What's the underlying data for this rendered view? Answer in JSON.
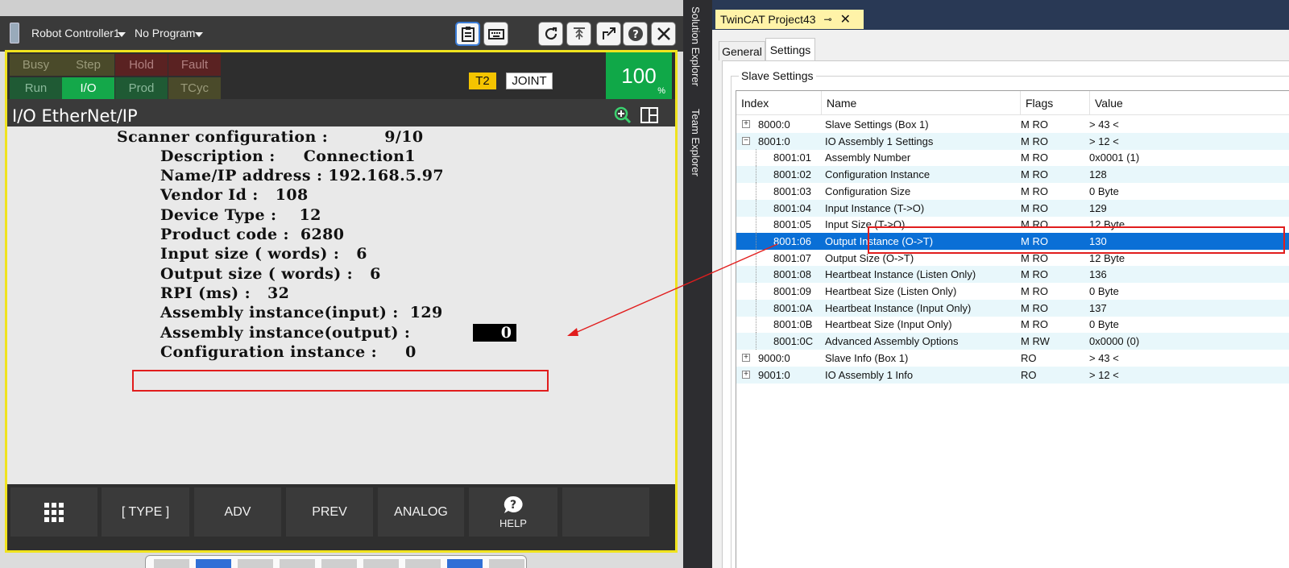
{
  "pendant": {
    "controller_name": "Robot Controller1",
    "program": "No Program",
    "status_row1": [
      {
        "label": "Busy",
        "bg": "#4a4a2a",
        "fg": "#9a9a7a"
      },
      {
        "label": "Step",
        "bg": "#4a4a2a",
        "fg": "#9a9a7a"
      },
      {
        "label": "Hold",
        "bg": "#5a2222",
        "fg": "#b08080"
      },
      {
        "label": "Fault",
        "bg": "#5a2222",
        "fg": "#b08080"
      }
    ],
    "status_row2": [
      {
        "label": "Run",
        "bg": "#1f5a34",
        "fg": "#8ab89a"
      },
      {
        "label": "I/O",
        "bg": "#14a84a",
        "fg": "#ffffff"
      },
      {
        "label": "Prod",
        "bg": "#1f5a34",
        "fg": "#8ab89a"
      },
      {
        "label": "TCyc",
        "bg": "#4a4a2a",
        "fg": "#9a9a7a"
      }
    ],
    "mode": "T2",
    "coord": "JOINT",
    "override": "100",
    "override_unit": "%",
    "page_title": "I/O EtherNet/IP",
    "lines": [
      "Scanner configuration :          9/10",
      "Description :     Connection1",
      "Name/IP address : 192.168.5.97",
      "Vendor Id :   108",
      "Device Type :    12",
      "Product code :  6280",
      "Input size ( words) :   6",
      "Output size ( words) :   6",
      "RPI (ms) :   32",
      "Assembly instance(input) :  129",
      "Assembly instance(output) :",
      "Configuration instance :     0"
    ],
    "edit_value": "0",
    "fkeys": {
      "type": "[ TYPE ]",
      "adv": "ADV",
      "prev": "PREV",
      "analog": "ANALOG",
      "help": "HELP"
    },
    "colors": {
      "frame": "#f0e31e",
      "highlight": "#e11d1d",
      "override": "#10a848"
    }
  },
  "vs": {
    "side_tabs": [
      "Solution Explorer",
      "Team Explorer"
    ]
  },
  "twincat": {
    "doc_tab": "TwinCAT Project43",
    "tabs": [
      "General",
      "Settings"
    ],
    "active_tab": "Settings",
    "group_label": "Slave Settings",
    "columns": [
      "Index",
      "Name",
      "Flags",
      "Value"
    ],
    "rows": [
      {
        "index": "8000:0",
        "name": "Slave Settings (Box 1)",
        "flags": "M RO",
        "value": "> 43 <",
        "expander": "+",
        "level": 0
      },
      {
        "index": "8001:0",
        "name": "IO Assembly 1 Settings",
        "flags": "M RO",
        "value": "> 12 <",
        "expander": "−",
        "level": 0
      },
      {
        "index": "8001:01",
        "name": "Assembly Number",
        "flags": "M RO",
        "value": "0x0001 (1)",
        "expander": "",
        "level": 1
      },
      {
        "index": "8001:02",
        "name": "Configuration Instance",
        "flags": "M RO",
        "value": "128",
        "expander": "",
        "level": 1
      },
      {
        "index": "8001:03",
        "name": "Configuration Size",
        "flags": "M RO",
        "value": "0 Byte",
        "expander": "",
        "level": 1
      },
      {
        "index": "8001:04",
        "name": "Input Instance (T->O)",
        "flags": "M RO",
        "value": "129",
        "expander": "",
        "level": 1
      },
      {
        "index": "8001:05",
        "name": "Input Size (T->O)",
        "flags": "M RO",
        "value": "12 Byte",
        "expander": "",
        "level": 1
      },
      {
        "index": "8001:06",
        "name": "Output Instance (O->T)",
        "flags": "M RO",
        "value": "130",
        "expander": "",
        "level": 1,
        "selected": true
      },
      {
        "index": "8001:07",
        "name": "Output Size (O->T)",
        "flags": "M RO",
        "value": "12 Byte",
        "expander": "",
        "level": 1
      },
      {
        "index": "8001:08",
        "name": "Heartbeat Instance (Listen Only)",
        "flags": "M RO",
        "value": "136",
        "expander": "",
        "level": 1
      },
      {
        "index": "8001:09",
        "name": "Heartbeat Size (Listen Only)",
        "flags": "M RO",
        "value": "0 Byte",
        "expander": "",
        "level": 1
      },
      {
        "index": "8001:0A",
        "name": "Heartbeat Instance (Input Only)",
        "flags": "M RO",
        "value": "137",
        "expander": "",
        "level": 1
      },
      {
        "index": "8001:0B",
        "name": "Heartbeat Size (Input Only)",
        "flags": "M RO",
        "value": "0 Byte",
        "expander": "",
        "level": 1
      },
      {
        "index": "8001:0C",
        "name": "Advanced Assembly Options",
        "flags": "M RW",
        "value": "0x0000 (0)",
        "expander": "",
        "level": 1
      },
      {
        "index": "9000:0",
        "name": "Slave Info (Box 1)",
        "flags": "RO",
        "value": "> 43 <",
        "expander": "+",
        "level": 0
      },
      {
        "index": "9001:0",
        "name": "IO Assembly 1 Info",
        "flags": "RO",
        "value": "> 12 <",
        "expander": "+",
        "level": 0
      }
    ],
    "colors": {
      "header": "#293955",
      "doc_tab": "#fff3a8",
      "row_alt": "#e8f7fb",
      "selected": "#0a6fd6"
    }
  }
}
